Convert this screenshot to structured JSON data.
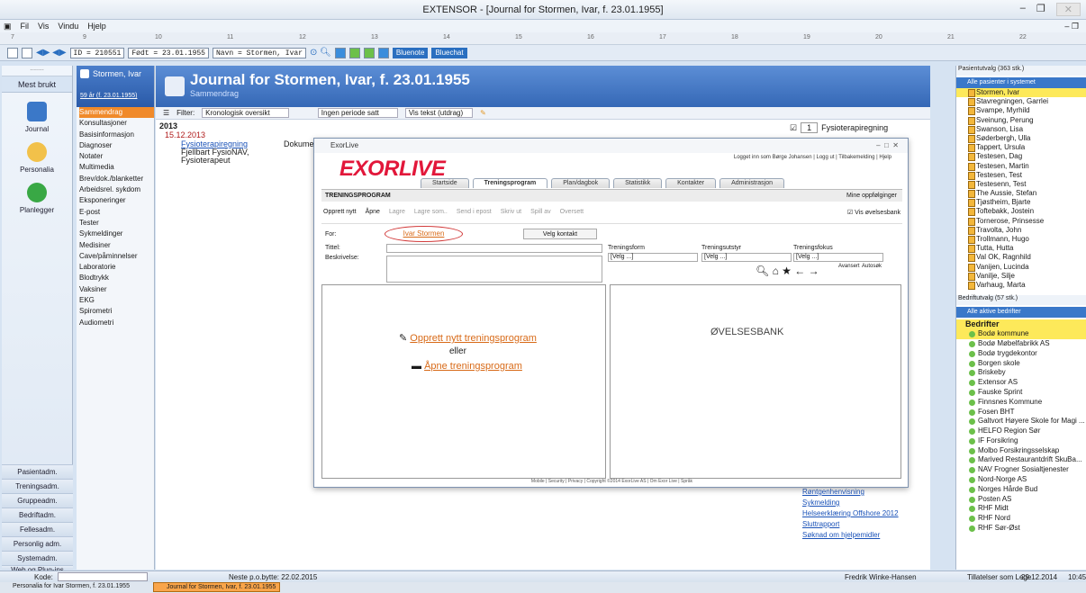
{
  "window": {
    "title": "EXTENSOR - [Journal for Stormen, Ivar, f. 23.01.1955]"
  },
  "menu": [
    "Fil",
    "Vis",
    "Vindu",
    "Hjelp"
  ],
  "ruler": [
    "7",
    "9",
    "10",
    "11",
    "12",
    "13",
    "14",
    "15",
    "16",
    "17",
    "18",
    "19",
    "20",
    "21",
    "22"
  ],
  "toolbar": {
    "id": "ID = 210551",
    "born": "Født = 23.01.1955",
    "name": "Navn = Stormen, Ivar",
    "bluenote": "Bluenote",
    "bluechat": "Bluechat"
  },
  "leftnav": {
    "dots": "........",
    "mest": "Mest brukt",
    "icons": [
      "Journal",
      "Personalia",
      "Planlegger"
    ],
    "buttons": [
      "Pasientadm.",
      "Treningsadm.",
      "Gruppeadm.",
      "Bedriftadm.",
      "Fellesadm.",
      "Personlig adm.",
      "Systemadm.",
      "Web og Plug-ins"
    ]
  },
  "journal_side": {
    "name": "Stormen, Ivar",
    "age": "59 år (f. 23.01.1955)",
    "items": [
      "Sammendrag",
      "Konsultasjoner",
      "Basisinformasjon",
      "Diagnoser",
      "Notater",
      "Multimedia",
      "Brev/dok./blanketter",
      "Arbeidsrel. sykdom",
      "Eksponeringer",
      "E-post",
      "Tester",
      "Sykmeldinger",
      "Medisiner",
      "Cave/påminnelser",
      "Laboratorie",
      "Blodtrykk",
      "Vaksiner",
      "EKG",
      "Spirometri",
      "Audiometri"
    ]
  },
  "main": {
    "title": "Journal for Stormen, Ivar, f. 23.01.1955",
    "subtitle": "Sammendrag",
    "filter": "Filter:",
    "filter_value": "Kronologisk oversikt",
    "period": "Ingen periode satt",
    "vis": "Vis tekst (utdrag)",
    "year": "2013",
    "date": "15.12.2013",
    "entry_link": "Fysioterapiregning",
    "entry_l2": "Fjellbart FysioNAV,",
    "entry_l3": "Fysioterapeut",
    "dokument": "Dokument",
    "right_count": "1",
    "right_label": "Fysioterapiregning",
    "docs": [
      "Røntgenhenvisning",
      "Sykmelding",
      "Helseerklæring Offshore 2012",
      "Sluttrapport",
      "Søknad om hjelpemidler"
    ]
  },
  "modal": {
    "title": "ExorLive",
    "logo_a": "EXOR",
    "logo_b": "LIVE",
    "login": "Logget inn som Børge Johansen | Logg ut | Tilbakemelding | Hjelp",
    "tabs": [
      "Startside",
      "Treningsprogram",
      "Plan/dagbok",
      "Statistikk",
      "Kontakter",
      "Administrasjon"
    ],
    "section": "TRENINGSPROGRAM",
    "mine": "Mine oppfølginger",
    "actions": [
      "Opprett nytt",
      "Åpne",
      "Lagre",
      "Lagre som..",
      "Send i epost",
      "Skriv ut",
      "Spill av",
      "Oversett"
    ],
    "vis_bank": "Vis øvelsesbank",
    "for_label": "For:",
    "for_value": "Ivar Stormen",
    "velg": "Velg kontakt",
    "tittel": "Tittel:",
    "beskrivelse": "Beskrivelse:",
    "form_label": "Treningsform",
    "utstyr_label": "Treningsutstyr",
    "fokus_label": "Treningsfokus",
    "velg_opt": "[Velg ...]",
    "avansert": "Avansert",
    "autosok": "Autosøk",
    "opprett": "Opprett nytt treningsprogram",
    "eller": "eller",
    "apne": "Åpne treningsprogram",
    "bank": "ØVELSESBANK",
    "footer": "Mobile | Security | Privacy | Copyright ©2014 ExorLive AS | Om Exor Live | Språk"
  },
  "patients": {
    "header": "Pasientutvalg (363 stk.)",
    "select": "Alle pasienter i systemet",
    "list": [
      "Stormen, Ivar",
      "Stavregningen, Garrlei",
      "Svampe, Myrhild",
      "Sveinung, Perung",
      "Swanson, Lisa",
      "Søderbergh, Ulla",
      "Tappert, Ursula",
      "Testesen, Dag",
      "Testesen, Martin",
      "Testesen, Test",
      "Testesenn, Test",
      "The Aussie, Stefan",
      "Tjøstheim, Bjarte",
      "Toftebakk, Jostein",
      "Tornerose, Prinsesse",
      "Travolta, John",
      "Trollmann, Hugo",
      "Tutta, Hutta",
      "Val OK, Ragnhild",
      "Vanijen, Lucinda",
      "Vanilje, Silje",
      "Varhaug, Marta"
    ]
  },
  "companies": {
    "header": "Bedriftutvalg (57 stk.)",
    "select": "Alle aktive bedrifter",
    "root": "Bedrifter",
    "list": [
      "Bodø kommune",
      "Bodø Møbelfabrikk AS",
      "Bodø trygdekontor",
      "Borgen skole",
      "Briskeby",
      "Extensor AS",
      "Fauske Sprint",
      "Finnsnes Kommune",
      "Fosen BHT",
      "Galtvort Høyere Skole for Magi ...",
      "HELFO Region Sør",
      "IF Forsikring",
      "Molbo Forsikringsselskap",
      "Marived Restaurantdrift SkuBa...",
      "NAV Frogner Sosialtjenester",
      "Nord-Norge AS",
      "Norges Hårde Bud",
      "Posten AS",
      "RHF Midt",
      "RHF Nord",
      "RHF Sør-Øst"
    ]
  },
  "status": {
    "kode": "Kode:",
    "neste": "Neste p.o.bytte: 22.02.2015",
    "user": "Fredrik Winke-Hansen",
    "rolle": "Tillatelser som Lege",
    "date": "29.12.2014",
    "time": "10:45"
  },
  "taskbar": [
    "Personalia for Ivar Stormen, f. 23.01.1955",
    "Journal for Stormen, Ivar, f. 23.01.1955"
  ]
}
